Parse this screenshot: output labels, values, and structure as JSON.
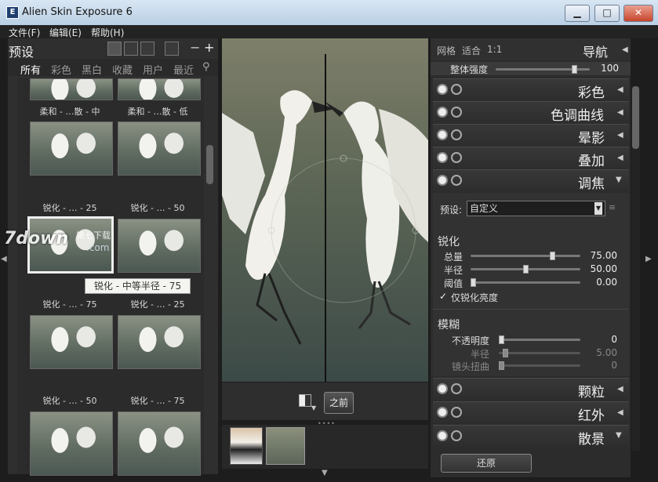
{
  "window": {
    "app_letter": "E",
    "title": "Alien Skin Exposure 6",
    "minimize": "▁",
    "maximize": "□",
    "close": "✕"
  },
  "menu": [
    "文件(F)",
    "编辑(E)",
    "帮助(H)"
  ],
  "presets": {
    "title": "预设",
    "tabs": [
      "所有",
      "彩色",
      "黑白",
      "收藏",
      "用户",
      "最近"
    ],
    "top_labels": [
      "柔和 - …散 - 中",
      "柔和 - …散 - 低"
    ],
    "rows": [
      [
        "锐化 - … - 25",
        "锐化 - … - 50"
      ],
      [
        "锐化 - … - 75",
        "锐化 - … - 25"
      ],
      [
        "锐化 - … - 50",
        "锐化 - … - 75"
      ]
    ],
    "tooltip": "锐化 - 中等半径 - 75",
    "minus": "−",
    "plus": "+"
  },
  "watermark": {
    "logo": "7down",
    "sub": "第七下载",
    "url": ".com"
  },
  "center": {
    "before_label": "之前"
  },
  "navigator": {
    "grid": "网格",
    "fit": "适合",
    "ratio": "1:1",
    "title": "导航"
  },
  "overall": {
    "label": "整体强度",
    "value": "100",
    "level": 0.85
  },
  "sections": {
    "color": "彩色",
    "curves": "色调曲线",
    "vignette": "晕影",
    "overlay": "叠加",
    "focus": "调焦",
    "grain": "颗粒",
    "ir": "红外",
    "bokeh": "散景"
  },
  "focus": {
    "preset_label": "预设:",
    "preset_value": "自定义",
    "sharpen_title": "锐化",
    "amount": {
      "label": "总量",
      "value": "75.00",
      "level": 0.75
    },
    "radius": {
      "label": "半径",
      "value": "50.00",
      "level": 0.5
    },
    "threshold": {
      "label": "阈值",
      "value": "0.00",
      "level": 0.0
    },
    "luma_only": "仅锐化亮度",
    "blur_title": "模糊",
    "opacity": {
      "label": "不透明度",
      "value": "0",
      "level": 0.0
    },
    "blur_radius": {
      "label": "半径",
      "value": "5.00",
      "level": 0.05
    },
    "lens_twist": {
      "label": "镜头扭曲",
      "value": "0",
      "level": 0.0
    }
  },
  "reset_button": "还原"
}
